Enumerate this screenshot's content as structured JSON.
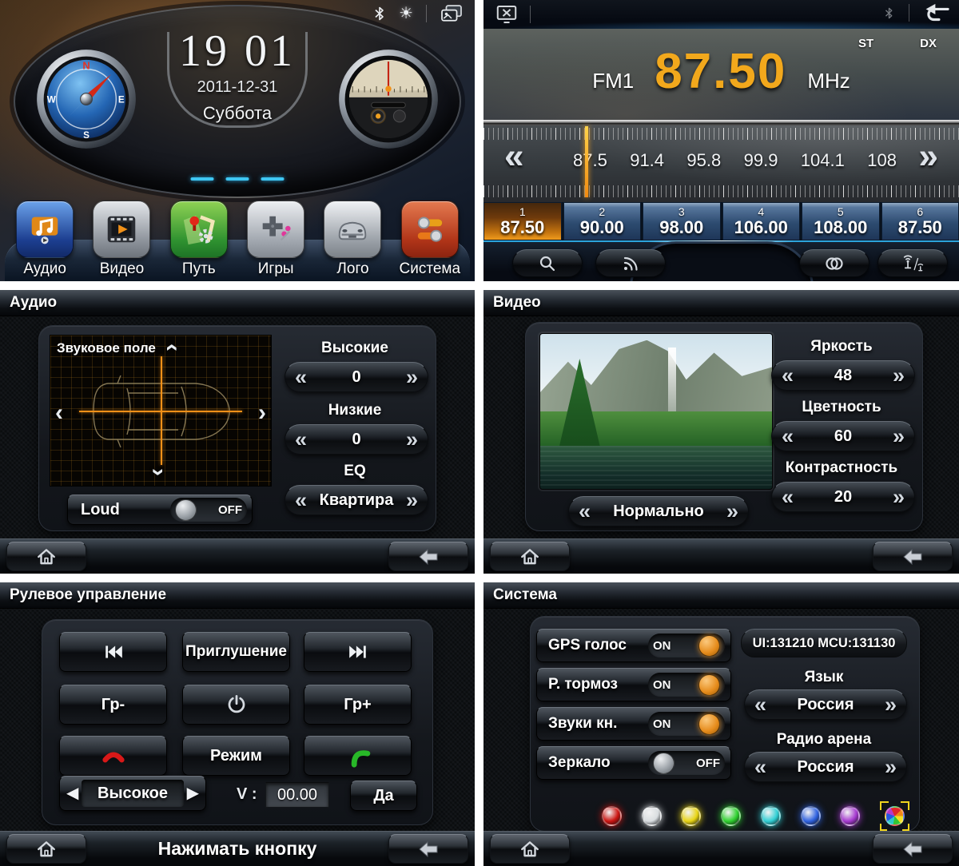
{
  "home": {
    "status": {
      "bluetooth_icon": "bluetooth",
      "brightness_icon": "sun-brightness",
      "wallpaper_icon": "wallpaper-frames"
    },
    "clock": {
      "time": "19 01",
      "date": "2011-12-31",
      "weekday": "Суббота"
    },
    "compass": {
      "n": "N",
      "e": "E",
      "s": "S",
      "w": "W"
    },
    "apps": [
      {
        "label": "Аудио",
        "icon": "music-note-icon"
      },
      {
        "label": "Видео",
        "icon": "film-play-icon"
      },
      {
        "label": "Путь",
        "icon": "map-navigation-icon"
      },
      {
        "label": "Игры",
        "icon": "gamepad-icon"
      },
      {
        "label": "Лого",
        "icon": "car-logo-icon"
      },
      {
        "label": "Система",
        "icon": "sliders-icon"
      }
    ]
  },
  "radio": {
    "band": "FM1",
    "frequency": "87.50",
    "unit": "MHz",
    "st_label": "ST",
    "dx_label": "DX",
    "scale_labels": [
      "87.5",
      "91.4",
      "95.8",
      "99.9",
      "104.1",
      "108"
    ],
    "seek_left": "«",
    "seek_right": "»",
    "presets": [
      {
        "num": "1",
        "freq": "87.50"
      },
      {
        "num": "2",
        "freq": "90.00"
      },
      {
        "num": "3",
        "freq": "98.00"
      },
      {
        "num": "4",
        "freq": "106.00"
      },
      {
        "num": "5",
        "freq": "108.00"
      },
      {
        "num": "6",
        "freq": "87.50"
      }
    ]
  },
  "audio": {
    "title": "Аудио",
    "sound_field_label": "Звуковое поле",
    "treble_label": "Высокие",
    "treble_value": "0",
    "bass_label": "Низкие",
    "bass_value": "0",
    "eq_label": "EQ",
    "eq_value": "Квартира",
    "loud_label": "Loud",
    "loud_state": "OFF"
  },
  "video": {
    "title": "Видео",
    "brightness_label": "Яркость",
    "brightness_value": "48",
    "color_label": "Цветность",
    "color_value": "60",
    "contrast_label": "Контрастность",
    "contrast_value": "20",
    "mode_value": "Нормально"
  },
  "swc": {
    "title": "Рулевое управление",
    "mute_label": "Приглушение",
    "vol_down_label": "Гр-",
    "vol_up_label": "Гр+",
    "mode_label": "Режим",
    "level_value": "Высокое",
    "v_label": "V :",
    "v_value": "00.00",
    "confirm_label": "Да",
    "hint": "Нажимать кнопку"
  },
  "system": {
    "title": "Система",
    "toggles": [
      {
        "label": "GPS голос",
        "state": "ON"
      },
      {
        "label": "Р. тормоз",
        "state": "ON"
      },
      {
        "label": "Звуки кн.",
        "state": "ON"
      },
      {
        "label": "Зеркало",
        "state": "OFF"
      }
    ],
    "version": "UI:131210 MCU:131130",
    "language_label": "Язык",
    "language_value": "Россия",
    "radio_area_label": "Радио арена",
    "radio_area_value": "Россия",
    "colors": [
      "#cc1512",
      "#d9dde0",
      "#e8d413",
      "#2fd12f",
      "#30cfd4",
      "#2f62e0",
      "#a539cf",
      "rainbow"
    ],
    "accent_orange": "#ef9b1d"
  }
}
